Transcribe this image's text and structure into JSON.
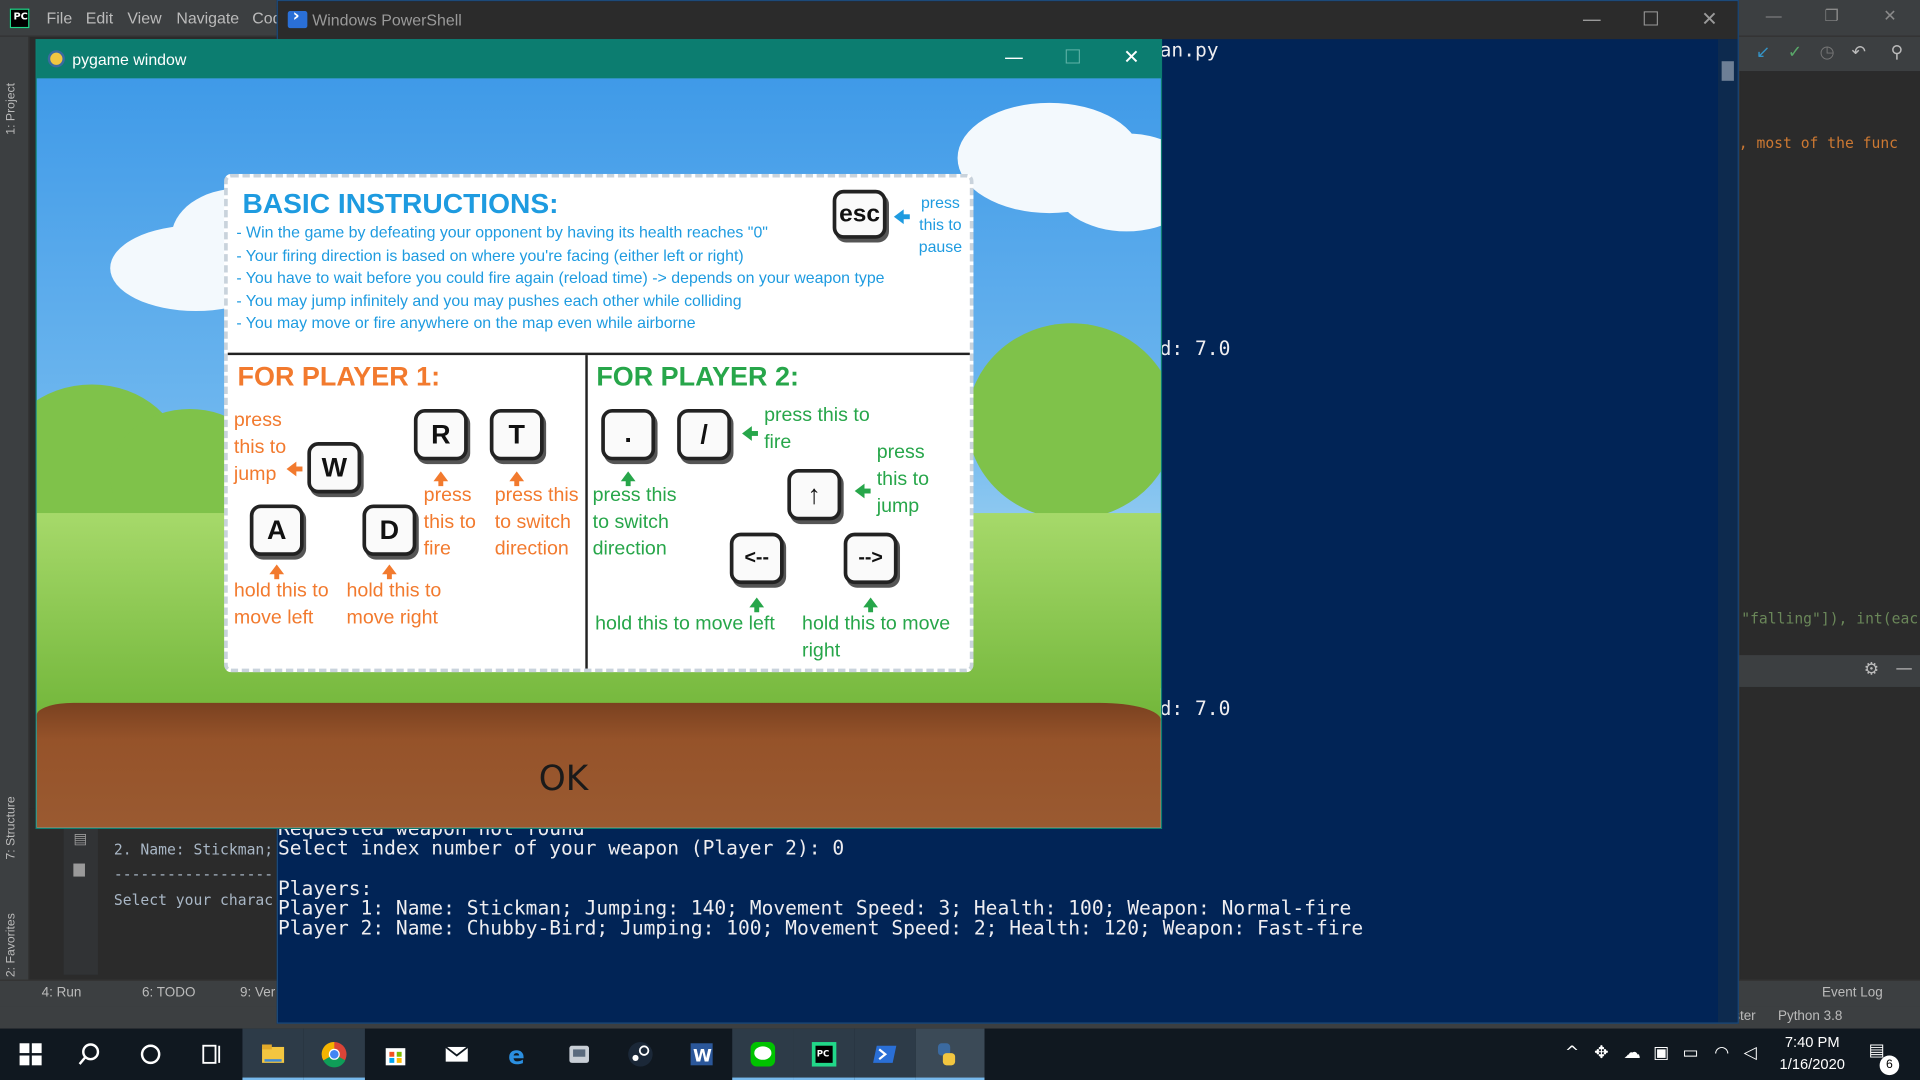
{
  "pycharm": {
    "menu": [
      "File",
      "Edit",
      "View",
      "Navigate",
      "Cod"
    ],
    "left_tabs": [
      "1: Project",
      "7: Structure",
      "2: Favorites"
    ],
    "run_lines": [
      "2. Name: Stickman;",
      "------------------",
      "Select your charac"
    ],
    "bottom_tabs": [
      "4: Run",
      "6: TODO",
      "9: Ver"
    ],
    "event_log": "Event Log",
    "status_python": "Python 3.8",
    "status_git": "Git: master",
    "code_fragment_1": ", most of the func",
    "code_fragment_2": "\"falling\"]), int(eac"
  },
  "powershell": {
    "title": "Windows PowerShell",
    "lines_top": [
      "an.py"
    ],
    "speed_line_1": "d: 7.0",
    "speed_line_2": "d: 7.0",
    "lines_bottom": [
      "Requested weapon not found",
      "Select index number of your weapon (Player 2): 0",
      "",
      "Players:",
      "Player 1: Name: Stickman; Jumping: 140; Movement Speed: 3; Health: 100; Weapon: Normal-fire",
      "Player 2: Name: Chubby-Bird; Jumping: 100; Movement Speed: 2; Health: 120; Weapon: Fast-fire"
    ]
  },
  "pygame": {
    "title": "pygame window",
    "ok_label": "OK",
    "basic_title": "BASIC INSTRUCTIONS:",
    "basic_lines": [
      "- Win the game by defeating your opponent by having its health reaches \"0\"",
      "- Your firing direction is based on where you're facing (either left or right)",
      "- You have to wait before you could fire again (reload time) -> depends on your weapon type",
      "- You may jump infinitely and you may pushes each other while colliding",
      "- You may move or fire anywhere on the map even while airborne"
    ],
    "esc_key": "esc",
    "esc_note": "press this to pause",
    "p1_title": "FOR PLAYER 1:",
    "p2_title": "FOR PLAYER 2:",
    "p1_keys": {
      "w": "W",
      "a": "A",
      "d": "D",
      "r": "R",
      "t": "T"
    },
    "p1_notes": {
      "jump": "press this to jump",
      "fire": "press this to fire",
      "switch": "press this to switch direction",
      "left": "hold this to move left",
      "right": "hold this to move right"
    },
    "p2_keys": {
      "dot": ".",
      "slash": "/",
      "up": "↑",
      "left": "<--",
      "right": "-->"
    },
    "p2_notes": {
      "fire": "press this to fire",
      "switch": "press this to switch direction",
      "jump": "press this to jump",
      "left": "hold this to move left",
      "right": "hold this to move right"
    }
  },
  "taskbar": {
    "time": "7:40 PM",
    "date": "1/16/2020",
    "notifications": "6",
    "apps": [
      "start-icon",
      "search-icon",
      "cortana-icon",
      "task-view-icon",
      "file-explorer-icon",
      "chrome-icon",
      "store-icon",
      "mail-icon",
      "edge-icon",
      "app-icon",
      "steam-icon",
      "word-icon",
      "line-icon",
      "pycharm-icon",
      "powershell-icon",
      "python-icon"
    ]
  },
  "colors": {
    "basic_blue": "#1e9be0",
    "p1_orange": "#f27a2e",
    "p2_green": "#27a64a",
    "ps_bg": "#012456"
  }
}
